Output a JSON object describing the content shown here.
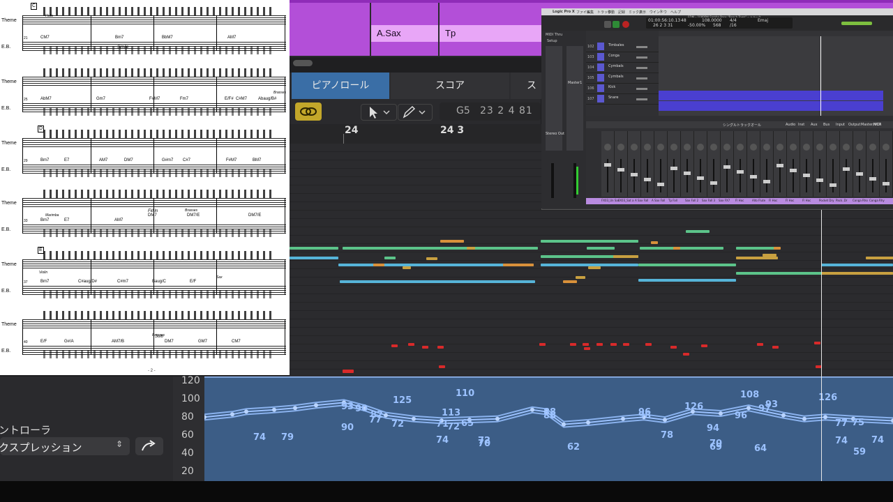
{
  "score": {
    "part_theme": "Theme",
    "part_eb": "E.B.",
    "page_number": "- 2 -",
    "rehearsal": [
      "C",
      "D",
      "E"
    ],
    "instrument_notes": [
      "Flute",
      "Brasses",
      "Marimba",
      "Brasses",
      "Violin",
      "Sax",
      "Brasses"
    ],
    "systems": [
      {
        "measure": "21",
        "chords": [
          "CM7",
          "Bm7",
          "BbM7",
          "AM7"
        ],
        "extra": "Simile"
      },
      {
        "measure": "25",
        "chords": [
          "AbM7",
          "Gm7",
          "F#M7",
          "Fm7",
          "E/F#",
          "C#M7",
          "Abaug/B#"
        ],
        "extra": ""
      },
      {
        "measure": "29",
        "chords": [
          "Bm7",
          "E7",
          "AM7",
          "DM7",
          "G#m7",
          "C#7",
          "F#M7",
          "BM7"
        ],
        "extra": ""
      },
      {
        "measure": "33",
        "chords": [
          "Bm7",
          "E7",
          "AM7",
          "DM7",
          "DM7/E",
          "DM7/E"
        ],
        "extra": "Fill In"
      },
      {
        "measure": "37",
        "chords": [
          "Bm7",
          "C#aug/D#",
          "C#m7",
          "Baug/C",
          "E/F"
        ],
        "extra": ""
      },
      {
        "measure": "40",
        "chords": [
          "E/F",
          "G#/A",
          "AM7/B",
          "DM7",
          "GM7",
          "CM7"
        ],
        "extra": "Solo"
      }
    ]
  },
  "tracks": {
    "regions": [
      {
        "name": "A.Sax"
      },
      {
        "name": "Tp"
      }
    ]
  },
  "editor": {
    "tabs": {
      "piano_roll": "ピアノロール",
      "score": "スコア",
      "step": "ス"
    },
    "position_note": "G5",
    "position_value": "23 2 4 81",
    "ruler": [
      "24",
      "24 3"
    ]
  },
  "controller": {
    "title": "ントローラ",
    "type_value": "クスプレッション",
    "y_axis": [
      "120",
      "100",
      "80",
      "60",
      "40",
      "20"
    ],
    "point_labels": [
      "93",
      "90",
      "90",
      "82",
      "77",
      "72",
      "71",
      "74",
      "65",
      "113",
      "110",
      "125",
      "74",
      "79",
      "72",
      "70",
      "72",
      "88",
      "88",
      "62",
      "96",
      "98",
      "78",
      "126",
      "94",
      "69",
      "70",
      "108",
      "96",
      "97",
      "93",
      "64",
      "126",
      "77",
      "75",
      "74",
      "59",
      "74"
    ]
  },
  "logic": {
    "title": "Logic Pro X",
    "doc_title": "EDM – 108BPM Samba Pops \"Beach Town\" – トラック",
    "menu": [
      "ファイル",
      "編集",
      "トラック",
      "移動",
      "記録",
      "ミックス",
      "表示",
      "ウインドウ",
      "?",
      "ヘルプ"
    ],
    "lcd": {
      "time": "01:00:56:10.13",
      "bars": "26  2  3  31",
      "tempo": "108.0000",
      "sig": "4/4",
      "div": "/16",
      "key": "Emaj",
      "cpu": "568",
      "extra": "-50.00%",
      "bpm_label": "48"
    },
    "track_names": [
      "Timbales",
      "Conga",
      "Cymbals",
      "Cymbals",
      "Kick",
      "Snare"
    ],
    "track_numbers": [
      "102",
      "103",
      "104",
      "105",
      "106",
      "107"
    ],
    "mixer_tabs": [
      "シングル",
      "トラック",
      "オール"
    ],
    "mixer_buttons": [
      "Audio",
      "Inst",
      "Aux",
      "Bus",
      "Input",
      "Output",
      "Master/VCA",
      "MIDI"
    ],
    "strip_labels": [
      "FX03_Un Sax",
      "FX03_Sat a",
      "A Sax Fall",
      "A Sax Fall",
      "Tp Fall",
      "Sax Fall 2",
      "Sax Fall 3",
      "Sax FX7",
      "Fl Hoc",
      "Alto Flute",
      "Fl Hoc",
      "Fl Hoc",
      "Fl Hoc",
      "Pocket Dry",
      "Pack..Dr",
      "Conga Rho",
      "Conga Rhy"
    ],
    "master": "Master1",
    "stereo_out": "Stereo Out",
    "setup": "Setup",
    "midi_thru": "MIDI Thru"
  },
  "colors": {
    "region_purple": "#b34fd8",
    "tab_blue": "#3a6ea6",
    "link_gold": "#c3a72a",
    "velocity_blue": "#3c5d86",
    "velocity_line": "#9cc2ff"
  }
}
